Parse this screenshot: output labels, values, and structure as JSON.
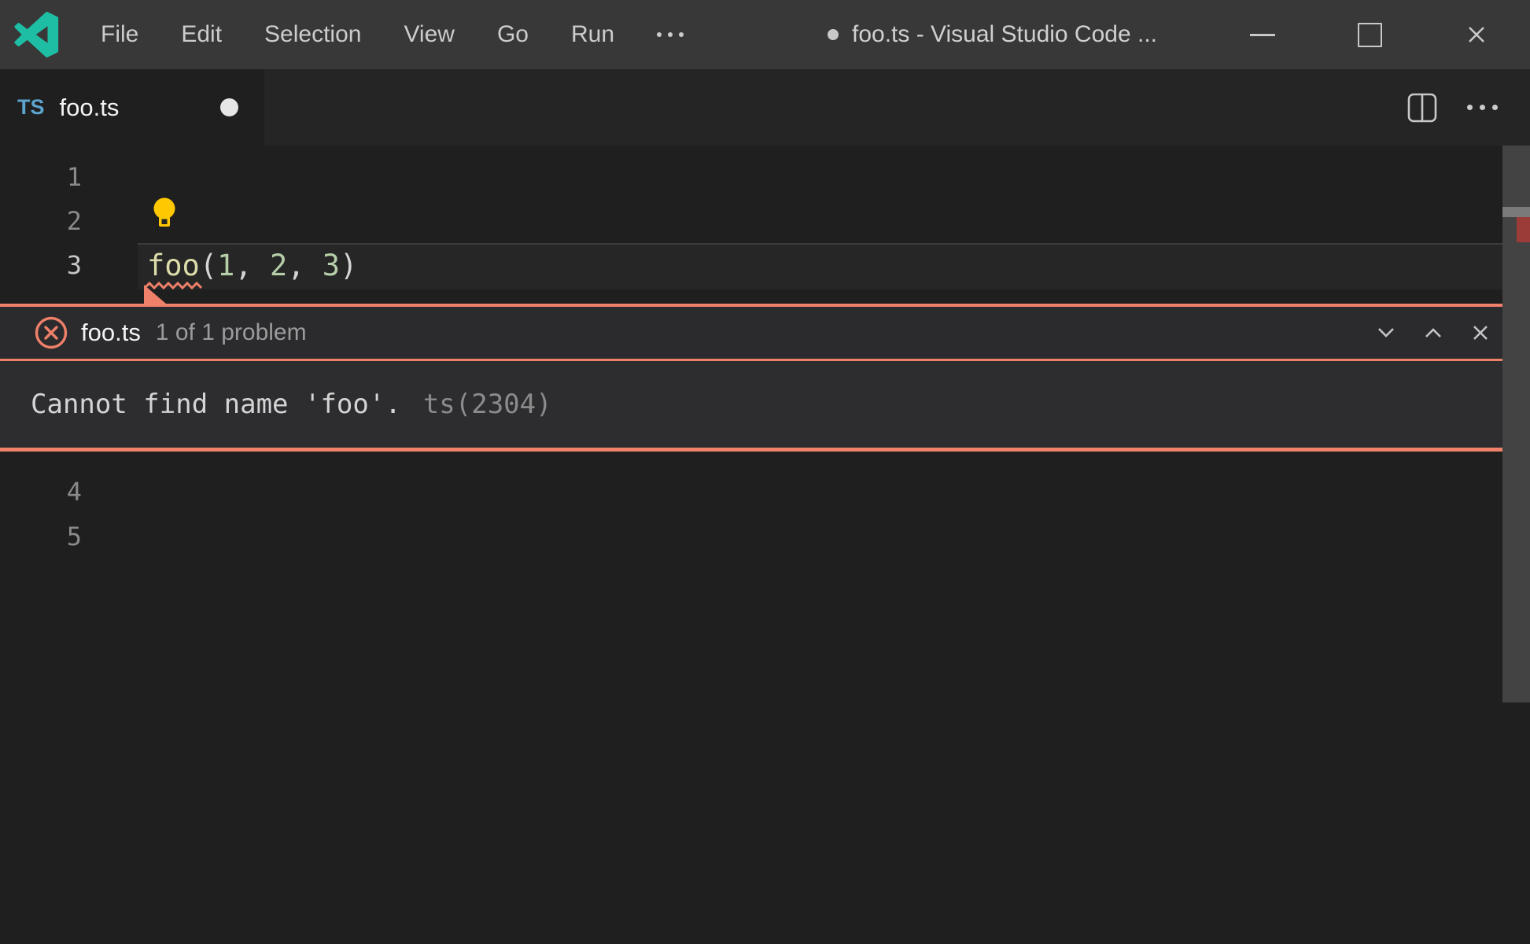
{
  "window": {
    "title": "foo.ts - Visual Studio Code ...",
    "menus": [
      "File",
      "Edit",
      "Selection",
      "View",
      "Go",
      "Run"
    ]
  },
  "tab_bar": {
    "active_tab": {
      "icon": "TS",
      "label": "foo.ts",
      "modified": true
    }
  },
  "editor": {
    "line_numbers": [
      "1",
      "2",
      "3",
      "4",
      "5"
    ],
    "active_line": "3",
    "code_line": {
      "tokens": [
        {
          "text": "foo",
          "color": "#DCDCAA"
        },
        {
          "text": "(",
          "color": "#D4D4D4"
        },
        {
          "text": "1",
          "color": "#B5CEA8"
        },
        {
          "text": ", ",
          "color": "#D4D4D4"
        },
        {
          "text": "2",
          "color": "#B5CEA8"
        },
        {
          "text": ", ",
          "color": "#D4D4D4"
        },
        {
          "text": "3",
          "color": "#B5CEA8"
        },
        {
          "text": ")",
          "color": "#D4D4D4"
        }
      ]
    }
  },
  "peek": {
    "file": "foo.ts",
    "count": "1 of 1 problem",
    "message": "Cannot find name 'foo'.",
    "source": "ts(2304)"
  },
  "colors": {
    "accent": "#EF8069",
    "bulb": "#FFC800",
    "logo": "#1EBEA5",
    "ts_icon": "#5CA3CE",
    "marker_red": "#9B3C38",
    "scrollbar_bg": "#434343",
    "slider": "#7A7A7A",
    "titlebar_bg": "#383838",
    "tabbar_bg": "#252526",
    "editor_bg": "#1F1F1F",
    "peek_header_bg": "#2B2B2E",
    "peek_body_bg": "#2D2D30"
  }
}
